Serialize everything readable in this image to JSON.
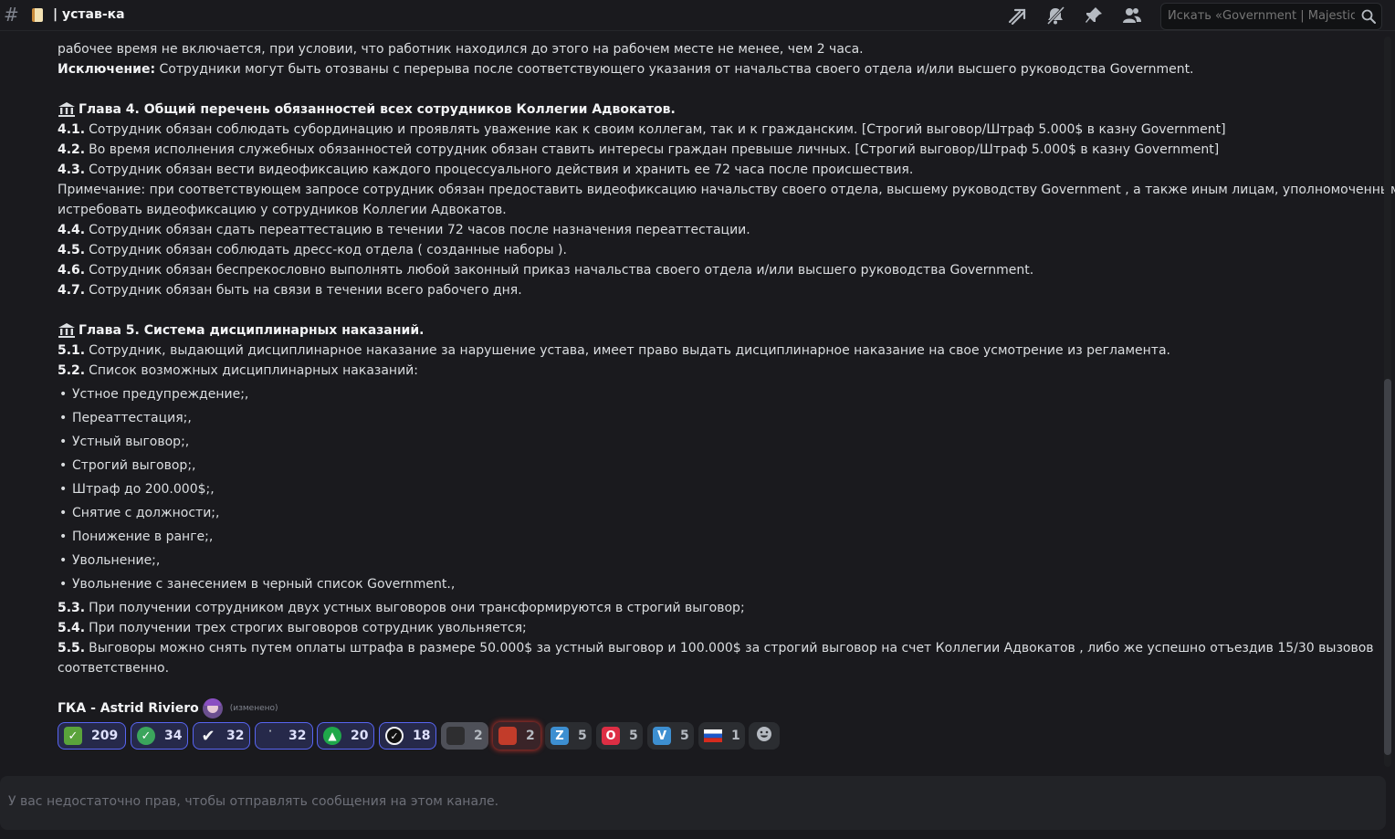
{
  "header": {
    "channel_name": "| устав-ка",
    "search_placeholder": "Искать «Government | Majestic ..."
  },
  "colors": {
    "accent": "#5865f2",
    "background": "#1a1a1e"
  },
  "message": {
    "lines": [
      {
        "t": "рабочее время не включается, при условии, что работник находился до этого на рабочем месте не менее, чем 2 часа."
      },
      {
        "b": "Исключение:",
        "t": " Сотрудники могут быть отозваны с перерыва после соответствующего указания от начальства своего отдела и/или высшего руководства Government."
      },
      {
        "chapter": "Глава 4. Общий перечень обязанностей всех сотрудников Коллегии Адвокатов."
      },
      {
        "n": "4.1.",
        "t": "Сотрудник обязан соблюдать субординацию и проявлять уважение как к своим коллегам, так и к гражданским. [Строгий выговор/Штраф 5.000$ в казну Government]"
      },
      {
        "n": "4.2.",
        "t": "Во время исполнения служебных обязанностей сотрудник обязан ставить интересы граждан превыше личных. [Строгий выговор/Штраф 5.000$ в казну Government]"
      },
      {
        "n": "4.3.",
        "t": "Сотрудник обязан вести видеофиксацию каждого процессуального действия и хранить ее 72 часа после происшествия."
      },
      {
        "t": "Примечание: при соответствующем запросе сотрудник обязан предоставить видеофиксацию начальству своего отдела, высшему руководству Government , а также иным лицам, уполномоченным"
      },
      {
        "t": "истребовать видеофиксацию у сотрудников Коллегии Адвокатов."
      },
      {
        "n": "4.4.",
        "t": "Сотрудник обязан сдать переаттестацию в течении 72 часов после назначения переаттестации."
      },
      {
        "n": "4.5.",
        "t": "Сотрудник обязан соблюдать  дресс-код отдела ( созданные наборы )."
      },
      {
        "n": "4.6.",
        "t": "Сотрудник обязан беспрекословно выполнять любой законный приказ начальства своего отдела и/или высшего руководства Government."
      },
      {
        "n": "4.7.",
        "t": "Сотрудник обязан быть на связи в течении всего рабочего дня."
      },
      {
        "chapter": "Глава 5. Система дисциплинарных наказаний."
      },
      {
        "n": "5.1.",
        "t": "Сотрудник, выдающий дисциплинарное наказание за нарушение устава, имеет право выдать дисциплинарное наказание на свое усмотрение из регламента."
      },
      {
        "n": "5.2.",
        "t": "Список возможных дисциплинарных наказаний:"
      }
    ],
    "bullets": [
      "Устное предупреждение;,",
      "Переаттестация;,",
      "Устный выговор;,",
      "Строгий выговор;,",
      "Штраф до 200.000$;,",
      "Снятие с должности;,",
      "Понижение в ранге;,",
      "Увольнение;,",
      "Увольнение с занесением в черный список Government.,"
    ],
    "after": [
      {
        "n": "5.3.",
        "t": "При получении сотрудником двух устных выговоров они трансформируются в строгий выговор;"
      },
      {
        "n": "5.4.",
        "t": "При получении трех строгих выговоров сотрудник увольняется;"
      },
      {
        "n": "5.5.",
        "t": "Выговоры можно снять путем оплаты штрафа в размере 50.000$ за устный выговор и 100.000$ за строгий выговор на счет Коллегии Адвокатов , либо же успешно отъездив 15/30 вызовов"
      },
      {
        "t": "соответственно."
      }
    ]
  },
  "author": {
    "name": "ГКА - Astrid Riviero",
    "edited": "(изменено)"
  },
  "reactions": [
    {
      "icon": "check-box-emoji",
      "count": "209",
      "active": true
    },
    {
      "icon": "check-circle-emoji",
      "count": "34",
      "active": true
    },
    {
      "icon": "check-mark-emoji",
      "count": "32",
      "active": true
    },
    {
      "icon": "dot-emoji",
      "count": "32",
      "active": true
    },
    {
      "icon": "arrow-up-circle-emoji",
      "count": "20",
      "active": true
    },
    {
      "icon": "verified-badge-emoji",
      "count": "18",
      "active": true
    },
    {
      "icon": "photo-emoji",
      "count": "2",
      "active": false
    },
    {
      "icon": "dota-emoji",
      "count": "2",
      "active": false
    },
    {
      "icon": "letter-z-emoji",
      "letter": "Z",
      "count": "5",
      "active": false
    },
    {
      "icon": "letter-o-emoji",
      "letter": "O",
      "count": "5",
      "active": false
    },
    {
      "icon": "letter-v-emoji",
      "letter": "V",
      "count": "5",
      "active": false
    },
    {
      "icon": "russia-flag-emoji",
      "count": "1",
      "active": false
    }
  ],
  "composer": {
    "notice": "У вас недостаточно прав, чтобы отправлять сообщения на этом канале."
  }
}
